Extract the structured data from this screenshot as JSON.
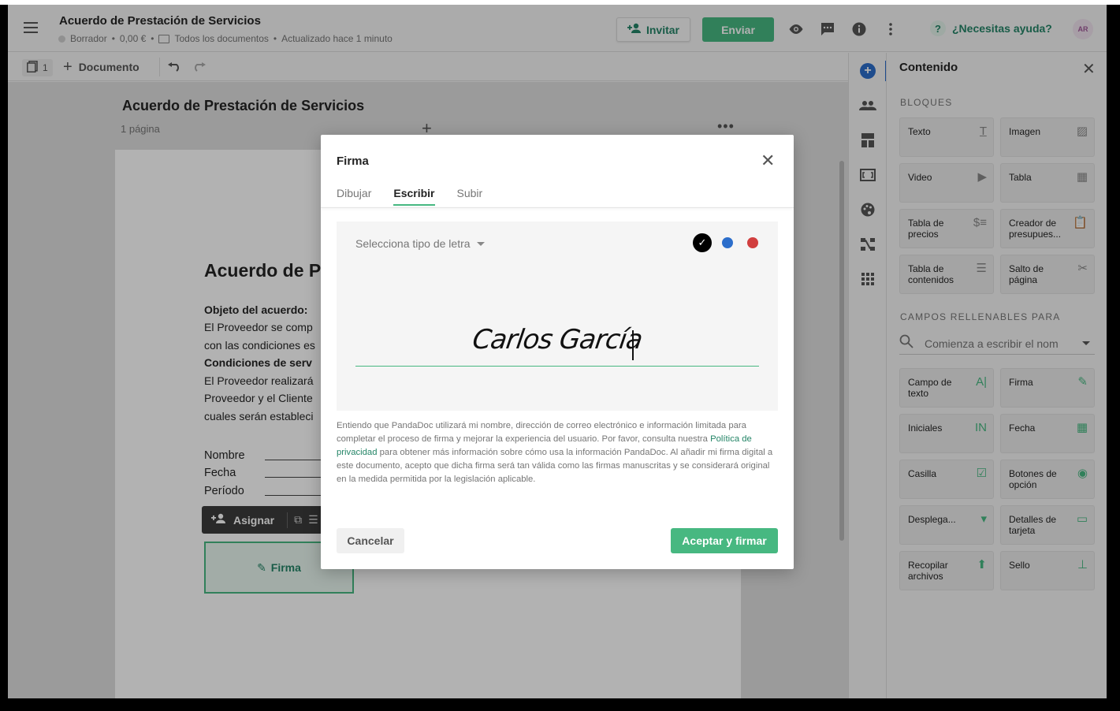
{
  "header": {
    "doc_title": "Acuerdo de Prestación de Servicios",
    "status": "Borrador",
    "amount": "0,00 €",
    "folder": "Todos los documentos",
    "updated": "Actualizado hace 1 minuto",
    "invite_label": "Invitar",
    "send_label": "Enviar",
    "help_label": "¿Necesitas ayuda?",
    "avatar_initials": "AR"
  },
  "toolbar": {
    "page_count": "1",
    "add_document_label": "Documento"
  },
  "canvas": {
    "title": "Acuerdo de Prestación de Servicios",
    "subtitle": "1 página",
    "page_heading": "Acuerdo de P",
    "lines": [
      "Objeto del acuerdo:",
      "El Proveedor se comp",
      "con las condiciones es",
      "Condiciones de serv",
      "El Proveedor realizará",
      "Proveedor y el Cliente",
      "cuales serán estableci"
    ],
    "fields": [
      "Nombre",
      "Fecha",
      "Período"
    ],
    "assign_label": "Asignar",
    "signature_field_label": "Firma"
  },
  "panel": {
    "title": "Contenido",
    "blocks_label": "BLOQUES",
    "blocks": [
      "Texto",
      "Imagen",
      "Video",
      "Tabla",
      "Tabla de precios",
      "Creador de presupues...",
      "Tabla de contenidos",
      "Salto de página"
    ],
    "fields_label": "CAMPOS RELLENABLES PARA",
    "search_placeholder": "Comienza a escribir el nom",
    "fields": [
      "Campo de texto",
      "Firma",
      "Iniciales",
      "Fecha",
      "Casilla",
      "Botones de opción",
      "Desplega...",
      "Detalles de tarjeta",
      "Recopilar archivos",
      "Sello"
    ]
  },
  "modal": {
    "title": "Firma",
    "tabs": [
      "Dibujar",
      "Escribir",
      "Subir"
    ],
    "font_select_label": "Selecciona tipo de letra",
    "signature_text": "Carlos García",
    "legal_before": "Entiendo que PandaDoc utilizará mi nombre, dirección de correo electrónico e información limitada para completar el proceso de firma y mejorar la experiencia del usuario. Por favor, consulta nuestra ",
    "legal_link": "Política de privacidad",
    "legal_after": " para obtener más información sobre cómo usa la información PandaDoc. Al añadir mi firma digital a este documento, acepto que dicha firma será tan válida como las firmas manuscritas y se considerará original en la medida permitida por la legislación aplicable.",
    "cancel_label": "Cancelar",
    "accept_label": "Aceptar y firmar",
    "colors": [
      "#000000",
      "#2c6ecb",
      "#d13f3f"
    ]
  }
}
